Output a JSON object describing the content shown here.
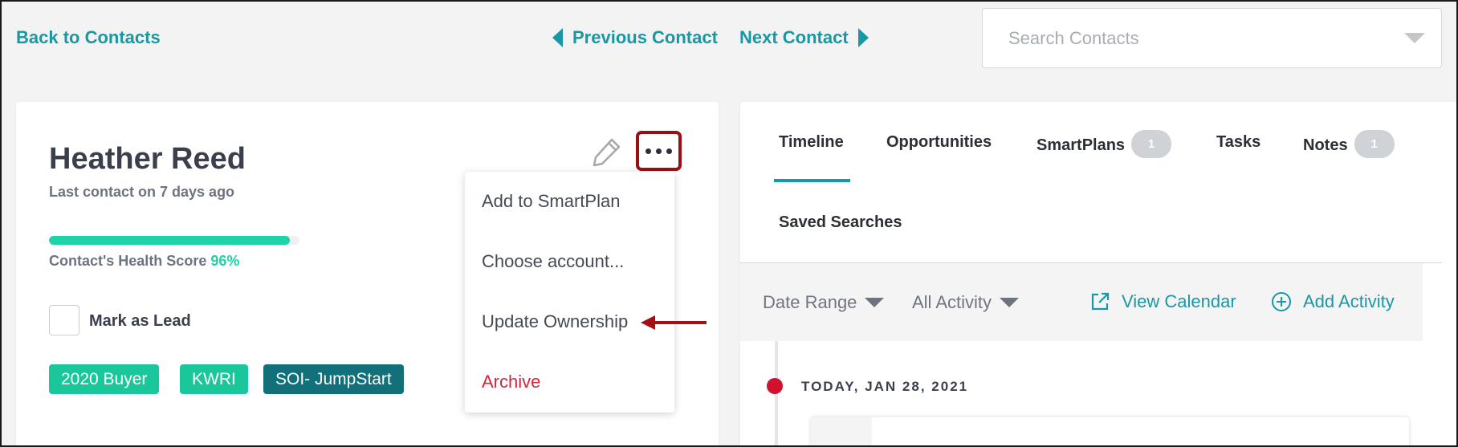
{
  "nav": {
    "back_label": "Back to Contacts",
    "prev_label": "Previous Contact",
    "next_label": "Next Contact",
    "search_placeholder": "Search Contacts"
  },
  "contact": {
    "name": "Heather Reed",
    "last_contact": "Last contact on 7 days ago",
    "health_label": "Contact's Health Score",
    "health_value": "96%",
    "health_fraction": 0.96,
    "mark_as_lead": "Mark as Lead",
    "tags": [
      "2020 Buyer",
      "KWRI",
      "SOI- JumpStart"
    ]
  },
  "menu": {
    "items": [
      "Add to SmartPlan",
      "Choose account...",
      "Update Ownership",
      "Archive"
    ]
  },
  "tabs": {
    "timeline": "Timeline",
    "opportunities": "Opportunities",
    "smartplans": "SmartPlans",
    "smartplans_count": "1",
    "tasks": "Tasks",
    "notes": "Notes",
    "notes_count": "1",
    "saved_searches": "Saved Searches"
  },
  "filters": {
    "date_range": "Date Range",
    "all_activity": "All Activity",
    "view_calendar": "View Calendar",
    "add_activity": "Add Activity"
  },
  "timeline": {
    "date_label": "TODAY, JAN 28, 2021"
  },
  "colors": {
    "accent": "#1a97a4",
    "health": "#1ed3a7",
    "tag_green": "#1ac79a",
    "tag_teal": "#12707a",
    "archive": "#d2263c",
    "highlight": "#9a1012",
    "timeline_dot": "#d2112e"
  },
  "icons": [
    "triangle-left-icon",
    "triangle-right-icon",
    "chevron-down-icon",
    "pencil-icon",
    "more-options-icon",
    "external-link-icon",
    "plus-circle-icon",
    "arrow-left-icon"
  ]
}
